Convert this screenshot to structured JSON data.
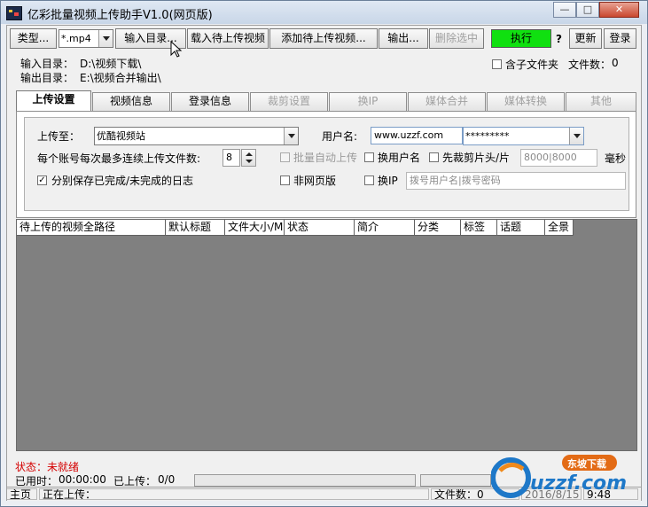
{
  "window": {
    "title": "亿彩批量视频上传助手V1.0(网页版)",
    "controls": {
      "minimize": "—",
      "maximize": "□",
      "close": "✕"
    }
  },
  "toolbar": {
    "type_button": "类型...",
    "type_combo": "*.mp4",
    "input_dir_button": "输入目录...",
    "load_videos_button": "载入待上传视频",
    "add_videos_button": "添加待上传视频...",
    "output_button": "输出...",
    "delete_selected_button": "删除选中",
    "execute_button": "执行",
    "help_button": "?",
    "update_button": "更新",
    "login_button": "登录"
  },
  "paths": {
    "input_label": "输入目录：",
    "input_value": "D:\\视频下载\\",
    "output_label": "输出目录：",
    "output_value": "E:\\视频合并输出\\",
    "subfolder_label": "含子文件夹",
    "file_count_label": "文件数：",
    "file_count_value": "0"
  },
  "tabs": [
    {
      "label": "上传设置",
      "state": "active"
    },
    {
      "label": "视频信息",
      "state": "normal"
    },
    {
      "label": "登录信息",
      "state": "normal"
    },
    {
      "label": "裁剪设置",
      "state": "disabled"
    },
    {
      "label": "换IP",
      "state": "disabled"
    },
    {
      "label": "媒体合并",
      "state": "disabled"
    },
    {
      "label": "媒体转换",
      "state": "disabled"
    },
    {
      "label": "其他",
      "state": "disabled"
    }
  ],
  "upload_settings": {
    "upload_to_label": "上传至：",
    "upload_to_value": "优酷视频站",
    "username_label": "用户名:",
    "username_value": "www.uzzf.com",
    "password_value": "*********",
    "max_files_label": "每个账号每次最多连续上传文件数:",
    "max_files_value": "8",
    "batch_auto_upload_label": "批量自动上传",
    "switch_user_label": "换用户名",
    "pre_cut_label": "先裁剪片头/片",
    "cut_ms_value": "8000|8000",
    "ms_unit": "毫秒",
    "save_log_label": "分别保存已完成/未完成的日志",
    "non_web_label": "非网页版",
    "switch_ip_label": "换IP",
    "dial_placeholder": "拨号用户名|拨号密码"
  },
  "table": {
    "columns": [
      "待上传的视频全路径",
      "默认标题",
      "文件大小/M",
      "状态",
      "简介",
      "分类",
      "标签",
      "话题",
      "全景"
    ]
  },
  "status": {
    "state_label": "状态：未就绪",
    "elapsed_label": "已用时：",
    "elapsed_value": "00:00:00",
    "uploaded_label": "已上传：",
    "uploaded_value": "0/0"
  },
  "statusbar": {
    "home": "主页",
    "uploading": "正在上传：",
    "file_count": "文件数：0",
    "date": "2016/8/15",
    "time": "9:48"
  },
  "watermark": {
    "text": "uzzf.com",
    "badge": "东坡下载"
  },
  "colors": {
    "execute_green": "#10e010",
    "status_red": "#d40000",
    "grid_grey": "#808080"
  }
}
